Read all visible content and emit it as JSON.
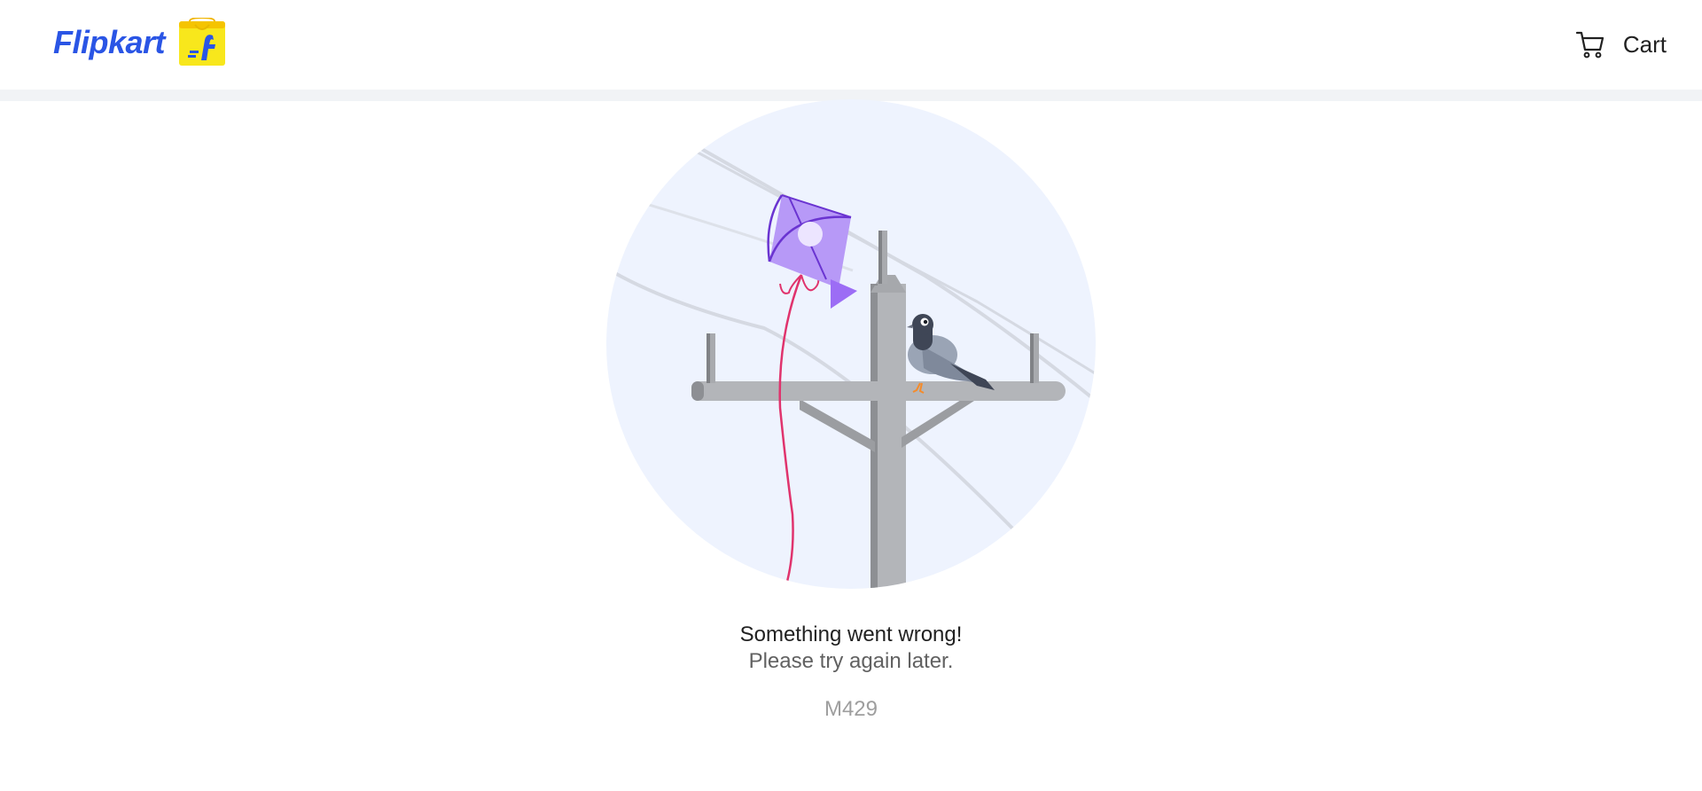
{
  "header": {
    "logo_text": "Flipkart",
    "logo_icon": "flipkart-shopping-bag-icon",
    "cart_icon": "shopping-cart-icon",
    "cart_label": "Cart",
    "brand_color": "#2a55e5",
    "bag_color": "#f8e71c"
  },
  "error": {
    "illustration": "kite-on-power-pole-with-pigeon",
    "title": "Something went wrong!",
    "subtitle": "Please try again later.",
    "code": "M429"
  }
}
